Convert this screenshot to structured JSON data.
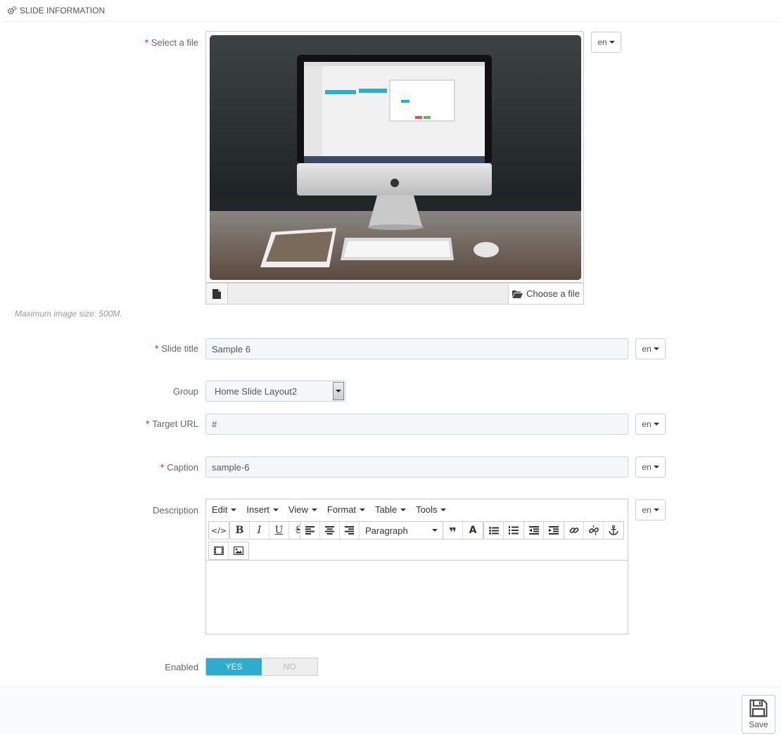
{
  "panel": {
    "title": "SLIDE INFORMATION"
  },
  "fields": {
    "file": {
      "label": "Select a file",
      "lang": "en",
      "choose_label": "Choose a file",
      "help": "Maximum image size: 500M."
    },
    "title": {
      "label": "Slide title",
      "value": "Sample 6",
      "lang": "en"
    },
    "group": {
      "label": "Group",
      "value": "Home Slide Layout2"
    },
    "url": {
      "label": "Target URL",
      "value": "#",
      "lang": "en"
    },
    "caption": {
      "label": "Caption",
      "value": "sample-6",
      "lang": "en"
    },
    "description": {
      "label": "Description",
      "lang": "en",
      "menus": [
        "Edit",
        "Insert",
        "View",
        "Format",
        "Table",
        "Tools"
      ],
      "format_dropdown": "Paragraph",
      "body": ""
    },
    "enabled": {
      "label": "Enabled",
      "yes": "YES",
      "no": "NO",
      "value": "YES"
    }
  },
  "footer": {
    "save_label": "Save"
  },
  "colors": {
    "accent": "#2eacce",
    "required": "#e2001a"
  }
}
